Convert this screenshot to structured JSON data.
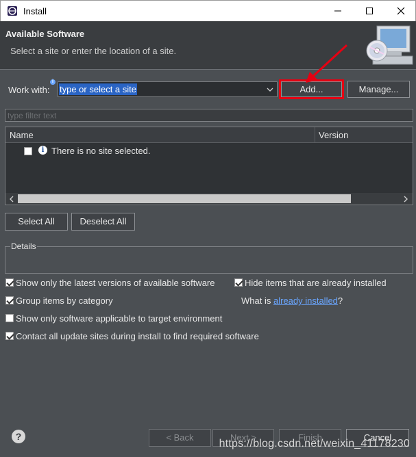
{
  "window": {
    "title": "Install",
    "icon": "eclipse-icon"
  },
  "header": {
    "title": "Available Software",
    "description": "Select a site or enter the location of a site.",
    "image": "wizard-banner-cd-icon"
  },
  "work_with": {
    "label": "Work with:",
    "value": "type or select a site",
    "add_button": "Add...",
    "manage_button": "Manage..."
  },
  "filter": {
    "placeholder": "type filter text"
  },
  "table": {
    "columns": [
      "Name",
      "Version"
    ],
    "empty_message": "There is no site selected."
  },
  "selection": {
    "select_all": "Select All",
    "deselect_all": "Deselect All"
  },
  "details": {
    "label": "Details"
  },
  "options": {
    "latest_versions": {
      "label": "Show only the latest versions of available software",
      "checked": true
    },
    "hide_installed": {
      "label": "Hide items that are already installed",
      "checked": true
    },
    "group_by_category": {
      "label": "Group items by category",
      "checked": true
    },
    "target_env": {
      "label": "Show only software applicable to target environment",
      "checked": false
    },
    "contact_sites": {
      "label": "Contact all update sites during install to find required software",
      "checked": true
    },
    "what_is_prefix": "What is ",
    "already_installed_link": "already installed",
    "what_is_suffix": "?"
  },
  "footer": {
    "back": "< Back",
    "next": "Next >",
    "finish": "Finish",
    "cancel": "Cancel"
  },
  "watermark": "https://blog.csdn.net/weixin_41178230",
  "colors": {
    "highlight": "#e60012",
    "selection": "#2a64c4",
    "link": "#6aa6ff"
  }
}
